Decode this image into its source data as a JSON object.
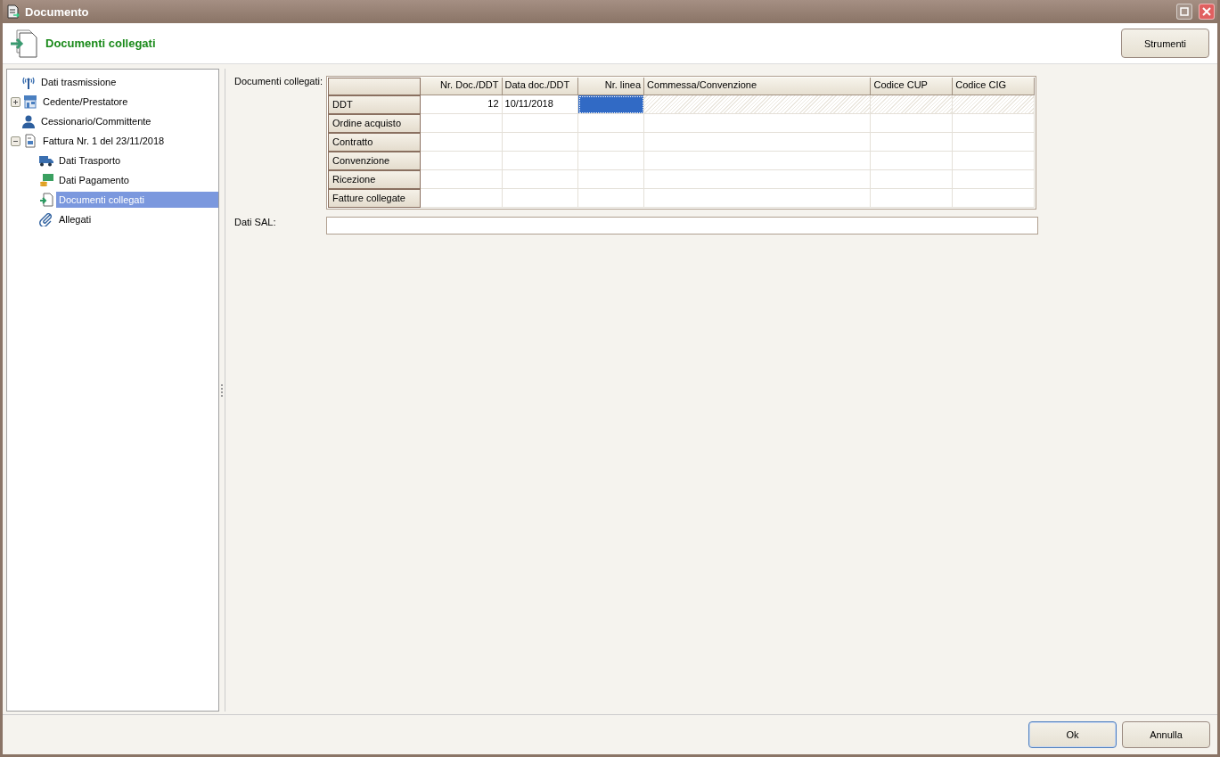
{
  "window": {
    "title": "Documento"
  },
  "header": {
    "title": "Documenti collegati",
    "tools_button": "Strumenti"
  },
  "tree": [
    {
      "label": "Dati trasmissione",
      "selected": false
    },
    {
      "label": "Cedente/Prestatore",
      "selected": false,
      "expanded": false
    },
    {
      "label": "Cessionario/Committente",
      "selected": false
    },
    {
      "label": "Fattura Nr. 1 del 23/11/2018",
      "selected": false,
      "expanded": true,
      "children": [
        {
          "label": "Dati Trasporto",
          "selected": false
        },
        {
          "label": "Dati Pagamento",
          "selected": false
        },
        {
          "label": "Documenti collegati",
          "selected": true
        },
        {
          "label": "Allegati",
          "selected": false
        }
      ]
    }
  ],
  "form": {
    "grid_label": "Documenti collegati:",
    "columns": [
      "Nr. Doc./DDT",
      "Data doc./DDT",
      "Nr. linea",
      "Commessa/Convenzione",
      "Codice CUP",
      "Codice CIG"
    ],
    "rows": [
      {
        "label": "DDT",
        "cells": [
          {
            "text": "12",
            "selected": false,
            "disabled": false
          },
          {
            "text": "10/11/2018",
            "selected": false,
            "disabled": false
          },
          {
            "text": "",
            "selected": true,
            "disabled": false
          },
          {
            "text": "",
            "selected": false,
            "disabled": true
          },
          {
            "text": "",
            "selected": false,
            "disabled": true
          },
          {
            "text": "",
            "selected": false,
            "disabled": true
          }
        ]
      },
      {
        "label": "Ordine acquisto",
        "cells": []
      },
      {
        "label": "Contratto",
        "cells": []
      },
      {
        "label": "Convenzione",
        "cells": []
      },
      {
        "label": "Ricezione",
        "cells": []
      },
      {
        "label": "Fatture collegate",
        "cells": []
      }
    ],
    "sal_label": "Dati SAL:"
  },
  "buttons": [
    {
      "label": "Ok",
      "default": true
    },
    {
      "label": "Annulla",
      "default": false
    }
  ]
}
